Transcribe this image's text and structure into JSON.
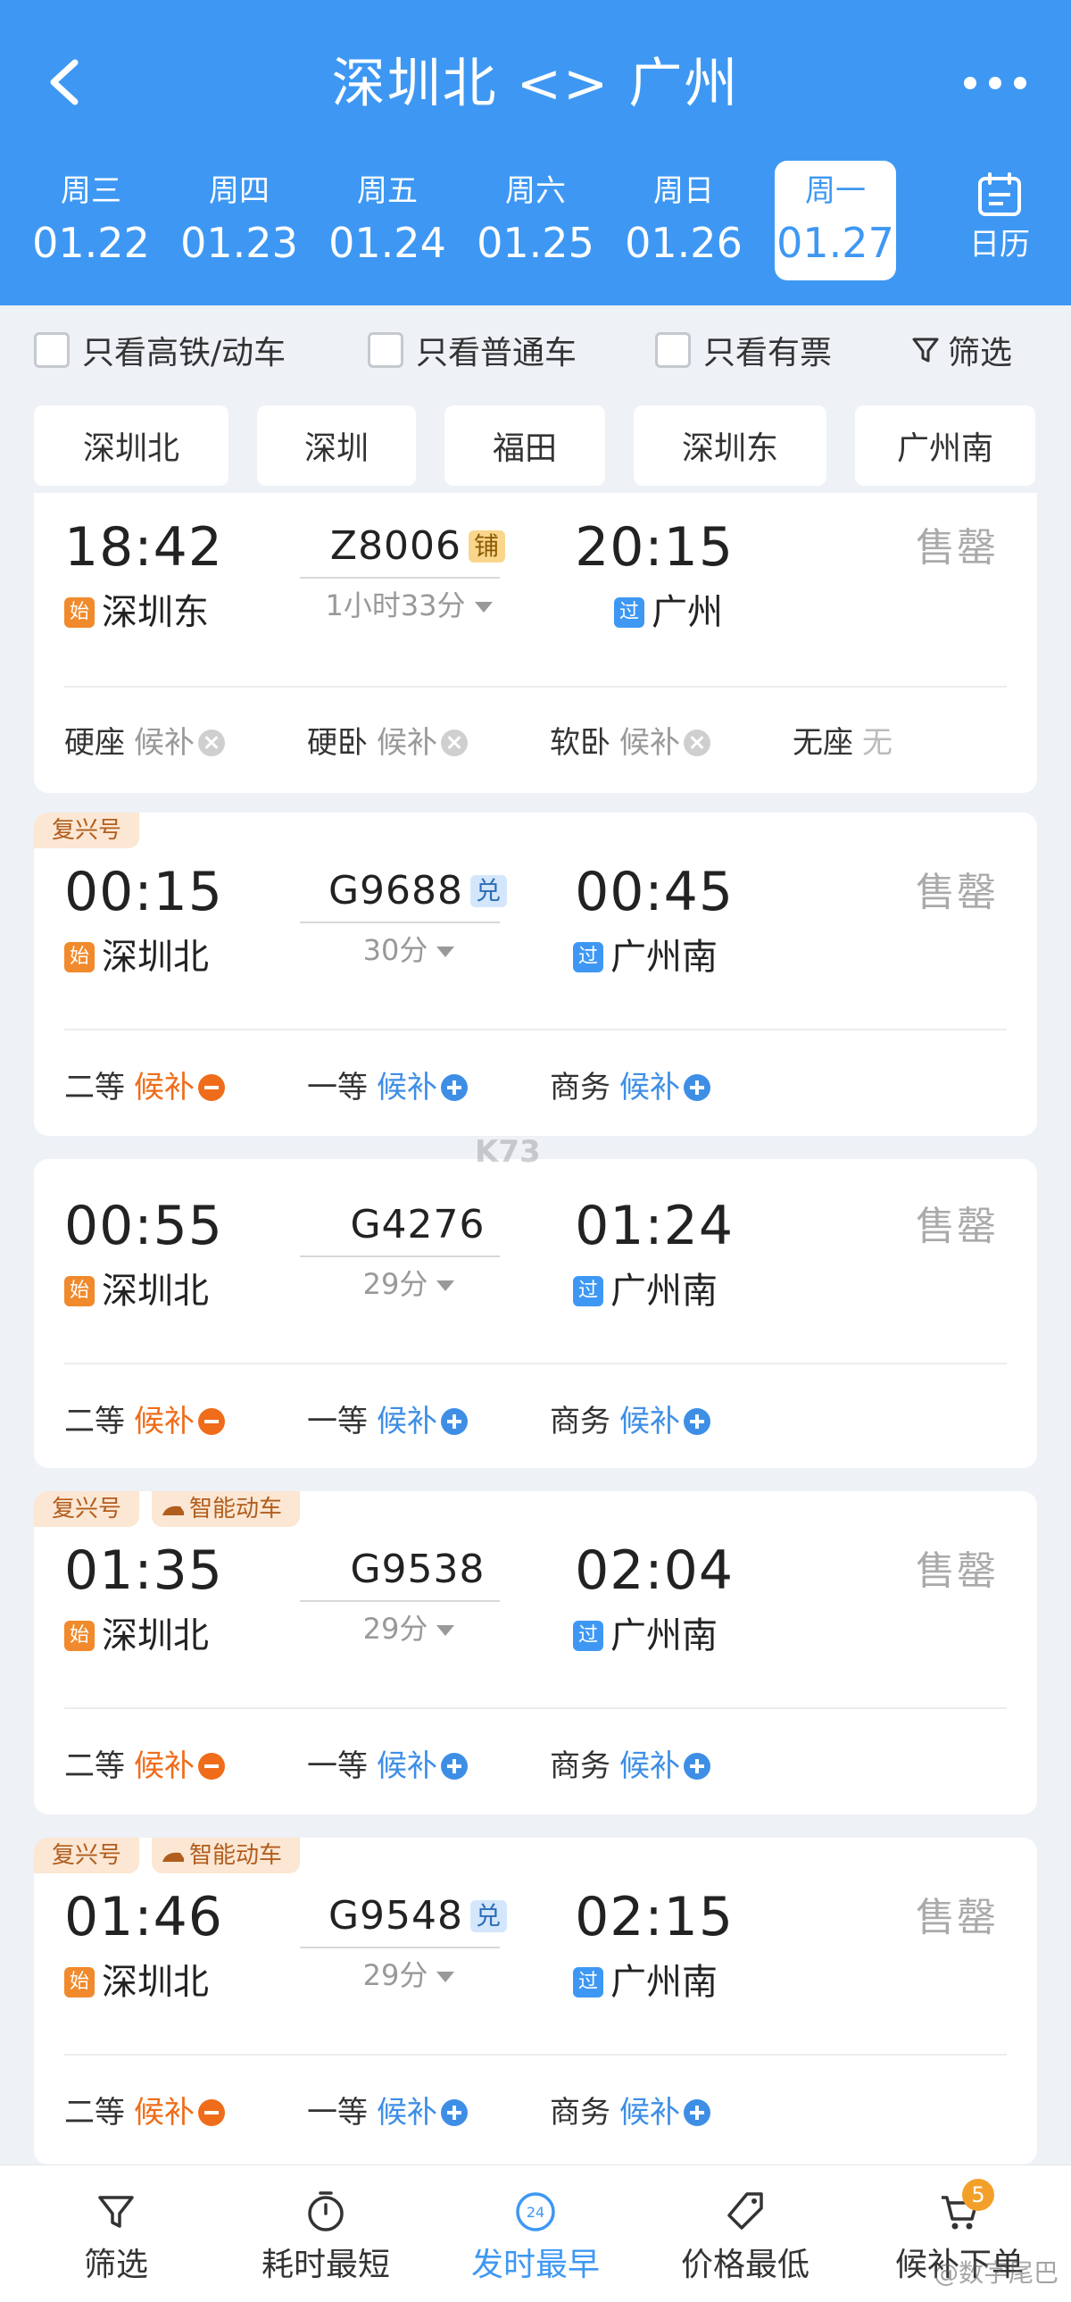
{
  "header": {
    "title": "深圳北 <> 广州",
    "calendar_label": "日历"
  },
  "dates": [
    {
      "weekday": "周三",
      "date": "01.22"
    },
    {
      "weekday": "周四",
      "date": "01.23"
    },
    {
      "weekday": "周五",
      "date": "01.24"
    },
    {
      "weekday": "周六",
      "date": "01.25"
    },
    {
      "weekday": "周日",
      "date": "01.26"
    },
    {
      "weekday": "周一",
      "date": "01.27",
      "selected": true
    }
  ],
  "filters": {
    "highspeed_only": "只看高铁/动车",
    "normal_only": "只看普通车",
    "available_only": "只看有票",
    "filter_label": "筛选"
  },
  "stations": [
    "深圳北",
    "深圳",
    "福田",
    "深圳东",
    "广州南"
  ],
  "trains": [
    {
      "tags": [],
      "dep_time": "18:42",
      "train_no": "Z8006",
      "no_badge": "铺",
      "arr_time": "20:15",
      "duration": "1小时33分",
      "dep_icon": "始",
      "dep_station": "深圳东",
      "arr_icon": "过",
      "arr_station": "广州",
      "status": "售罄",
      "seats": [
        {
          "type": "硬座",
          "status": "候补"
        },
        {
          "type": "硬卧",
          "status": "候补"
        },
        {
          "type": "软卧",
          "status": "候补"
        },
        {
          "type": "无座",
          "status": "无"
        }
      ]
    },
    {
      "tags": [
        "复兴号"
      ],
      "dep_time": "00:15",
      "train_no": "G9688",
      "no_badge": "兑",
      "arr_time": "00:45",
      "duration": "30分",
      "dep_icon": "始",
      "dep_station": "深圳北",
      "arr_icon": "过",
      "arr_station": "广州南",
      "status": "售罄",
      "seats": [
        {
          "type": "二等",
          "status": "候补"
        },
        {
          "type": "一等",
          "status": "候补"
        },
        {
          "type": "商务",
          "status": "候补"
        }
      ]
    },
    {
      "tags": [],
      "dep_time": "00:55",
      "train_no": "G4276",
      "no_badge": "",
      "arr_time": "01:24",
      "duration": "29分",
      "dep_icon": "始",
      "dep_station": "深圳北",
      "arr_icon": "过",
      "arr_station": "广州南",
      "status": "售罄",
      "seats": [
        {
          "type": "二等",
          "status": "候补"
        },
        {
          "type": "一等",
          "status": "候补"
        },
        {
          "type": "商务",
          "status": "候补"
        }
      ]
    },
    {
      "tags": [
        "复兴号",
        "智能动车"
      ],
      "dep_time": "01:35",
      "train_no": "G9538",
      "no_badge": "",
      "arr_time": "02:04",
      "duration": "29分",
      "dep_icon": "始",
      "dep_station": "深圳北",
      "arr_icon": "过",
      "arr_station": "广州南",
      "status": "售罄",
      "seats": [
        {
          "type": "二等",
          "status": "候补"
        },
        {
          "type": "一等",
          "status": "候补"
        },
        {
          "type": "商务",
          "status": "候补"
        }
      ]
    },
    {
      "tags": [
        "复兴号",
        "智能动车"
      ],
      "dep_time": "01:46",
      "train_no": "G9548",
      "no_badge": "兑",
      "arr_time": "02:15",
      "duration": "29分",
      "dep_icon": "始",
      "dep_station": "深圳北",
      "arr_icon": "过",
      "arr_station": "广州南",
      "status": "售罄",
      "seats": [
        {
          "type": "二等",
          "status": "候补"
        },
        {
          "type": "一等",
          "status": "候补"
        },
        {
          "type": "商务",
          "status": "候补"
        }
      ]
    }
  ],
  "watermark": "K73",
  "bottom_bar": [
    {
      "label": "筛选",
      "icon": "filter-icon"
    },
    {
      "label": "耗时最短",
      "icon": "timer-icon"
    },
    {
      "label": "发时最早",
      "icon": "clock-24-icon",
      "active": true
    },
    {
      "label": "价格最低",
      "icon": "price-tag-icon"
    },
    {
      "label": "候补下单",
      "icon": "cart-icon"
    }
  ],
  "cart_count": "5",
  "corner_watermark": "@数字尾巴",
  "colors": {
    "primary": "#3e98f3",
    "waitlist_orange": "#ef6c1a",
    "waitlist_blue": "#3e8ee6",
    "sold_out": "#aaaaaa"
  }
}
